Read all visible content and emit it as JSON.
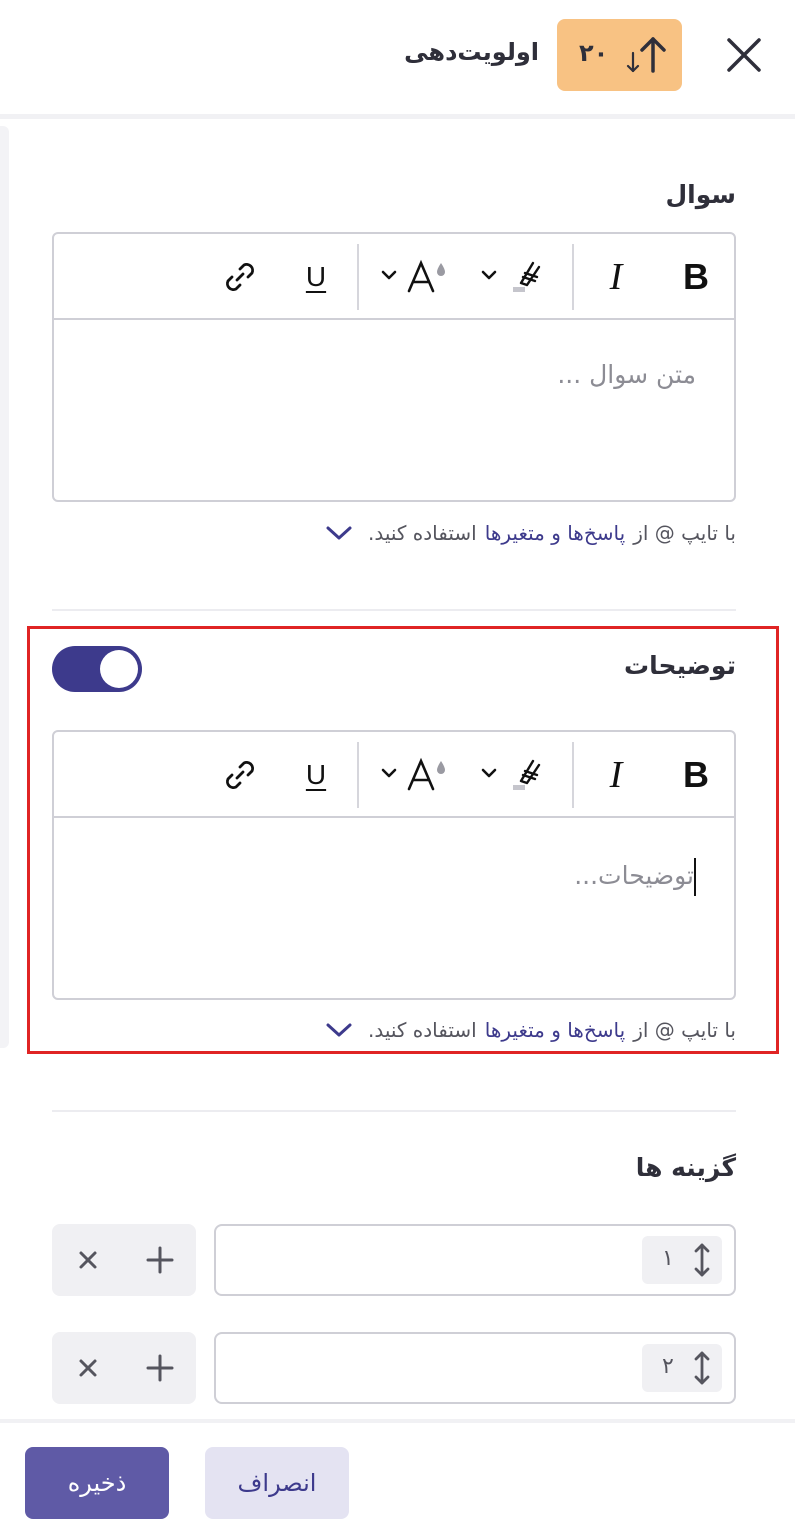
{
  "header": {
    "title": "اولویت‌دهی",
    "badge_number": "۲۰",
    "badge_icon": "sort-arrows-icon",
    "close_icon": "close-icon"
  },
  "question": {
    "label": "سوال",
    "placeholder": "متن سوال ...",
    "hint_prefix": "با تایپ @ از",
    "hint_link": "پاسخ‌ها و متغیرها",
    "hint_suffix": "استفاده کنید."
  },
  "description": {
    "label": "توضیحات",
    "toggle_on": true,
    "placeholder": "توضیحات...",
    "hint_prefix": "با تایپ @ از",
    "hint_link": "پاسخ‌ها و متغیرها",
    "hint_suffix": "استفاده کنید."
  },
  "toolbar": {
    "bold": "B",
    "italic": "I",
    "underline": "U",
    "font_color": "A"
  },
  "options": {
    "label": "گزینه ها",
    "items": [
      {
        "index": "۱",
        "value": ""
      },
      {
        "index": "۲",
        "value": ""
      }
    ]
  },
  "footer": {
    "save_label": "ذخیره",
    "cancel_label": "انصراف"
  },
  "colors": {
    "primary": "#3d3a8c",
    "save_button": "#5f5aa6",
    "badge": "#f8c283",
    "highlight": "#e02424"
  }
}
